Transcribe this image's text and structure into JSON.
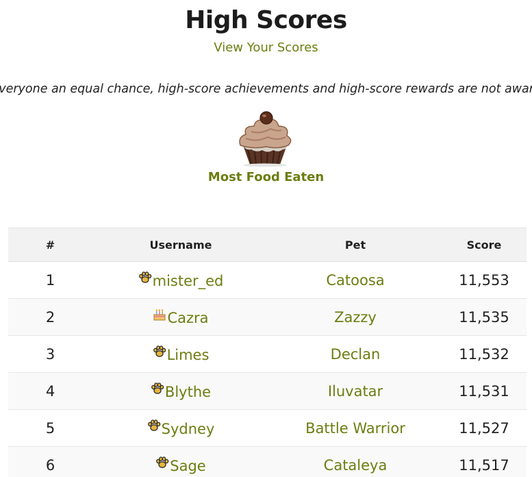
{
  "header": {
    "title": "High Scores",
    "view_link": "View Your Scores"
  },
  "notice": "To give everyone an equal chance, high-score achievements and high-score rewards are not awarded during",
  "category": {
    "name": "Most Food Eaten",
    "icon": "cupcake-icon"
  },
  "table": {
    "columns": [
      "#",
      "Username",
      "Pet",
      "Score"
    ],
    "rows": [
      {
        "rank": "1",
        "username": "mister_ed",
        "user_icon": "paw-icon",
        "pet": "Catoosa",
        "score": "11,553"
      },
      {
        "rank": "2",
        "username": "Cazra",
        "user_icon": "birthday-cake-icon",
        "pet": "Zazzy",
        "score": "11,535"
      },
      {
        "rank": "3",
        "username": "Limes",
        "user_icon": "paw-icon",
        "pet": "Declan",
        "score": "11,532"
      },
      {
        "rank": "4",
        "username": "Blythe",
        "user_icon": "paw-icon",
        "pet": "Iluvatar",
        "score": "11,531"
      },
      {
        "rank": "5",
        "username": "Sydney",
        "user_icon": "paw-icon",
        "pet": "Battle Warrior",
        "score": "11,527"
      },
      {
        "rank": "6",
        "username": "Sage",
        "user_icon": "paw-icon",
        "pet": "Cataleya",
        "score": "11,517"
      }
    ]
  },
  "colors": {
    "link": "#6d7d10",
    "header_bg": "#f2f2f2",
    "row_alt_bg": "#f9f9f9"
  }
}
